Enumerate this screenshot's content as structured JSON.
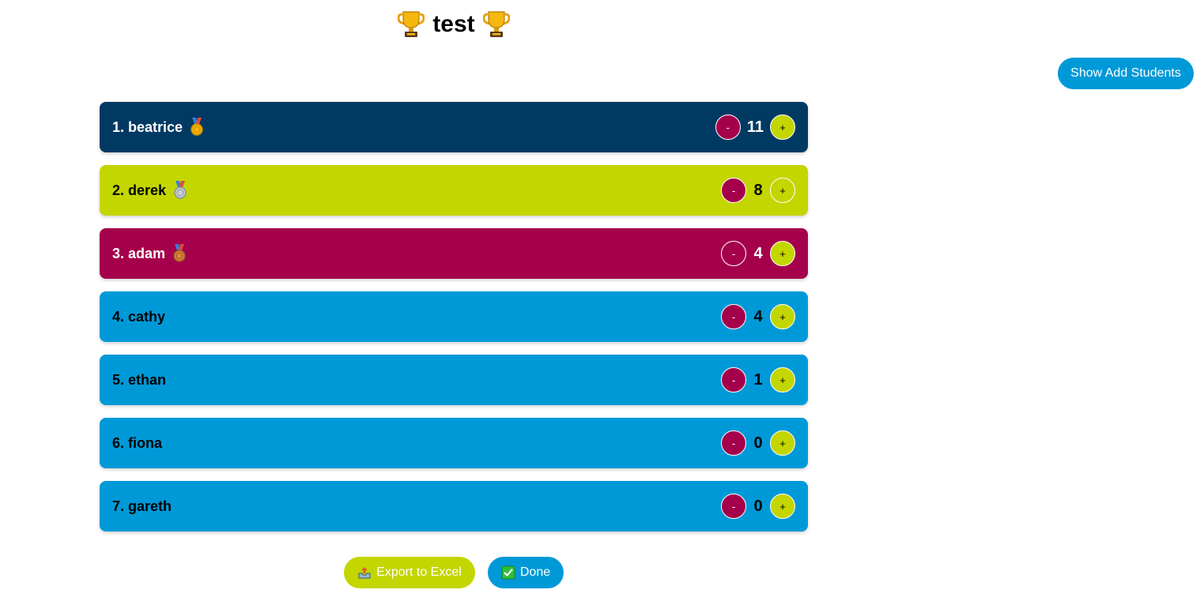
{
  "header": {
    "title": "test",
    "title_icon": "trophy-icon"
  },
  "toolbar": {
    "show_add_students_label": "Show Add Students"
  },
  "students": [
    {
      "rank_label": "1. beatrice",
      "score": "11",
      "medal": "gold-medal-icon",
      "bg": "#003a63",
      "text_color": "#ffffff",
      "minus_bg": "#a5004b",
      "plus_bg": "#c3d600",
      "minus_label": "-",
      "plus_label": "+"
    },
    {
      "rank_label": "2. derek",
      "score": "8",
      "medal": "silver-medal-icon",
      "bg": "#c3d600",
      "text_color": "#000000",
      "minus_bg": "#a5004b",
      "plus_bg": "#c3d600",
      "minus_label": "-",
      "plus_label": "+"
    },
    {
      "rank_label": "3. adam",
      "score": "4",
      "medal": "bronze-medal-icon",
      "bg": "#a5004b",
      "text_color": "#ffffff",
      "minus_bg": "#a5004b",
      "plus_bg": "#c3d600",
      "minus_label": "-",
      "plus_label": "+"
    },
    {
      "rank_label": "4. cathy",
      "score": "4",
      "medal": "",
      "bg": "#0099d8",
      "text_color": "#000000",
      "minus_bg": "#a5004b",
      "plus_bg": "#c3d600",
      "minus_label": "-",
      "plus_label": "+"
    },
    {
      "rank_label": "5. ethan",
      "score": "1",
      "medal": "",
      "bg": "#0099d8",
      "text_color": "#000000",
      "minus_bg": "#a5004b",
      "plus_bg": "#c3d600",
      "minus_label": "-",
      "plus_label": "+"
    },
    {
      "rank_label": "6. fiona",
      "score": "0",
      "medal": "",
      "bg": "#0099d8",
      "text_color": "#000000",
      "minus_bg": "#a5004b",
      "plus_bg": "#c3d600",
      "minus_label": "-",
      "plus_label": "+"
    },
    {
      "rank_label": "7. gareth",
      "score": "0",
      "medal": "",
      "bg": "#0099d8",
      "text_color": "#000000",
      "minus_bg": "#a5004b",
      "plus_bg": "#c3d600",
      "minus_label": "-",
      "plus_label": "+"
    }
  ],
  "footer": {
    "export_label": "Export to Excel",
    "export_icon": "outbox-tray-icon",
    "done_label": "Done",
    "done_icon": "check-mark-button-icon"
  },
  "colors": {
    "navy": "#003a63",
    "lime": "#c3d600",
    "magenta": "#a5004b",
    "blue": "#0099d8"
  }
}
